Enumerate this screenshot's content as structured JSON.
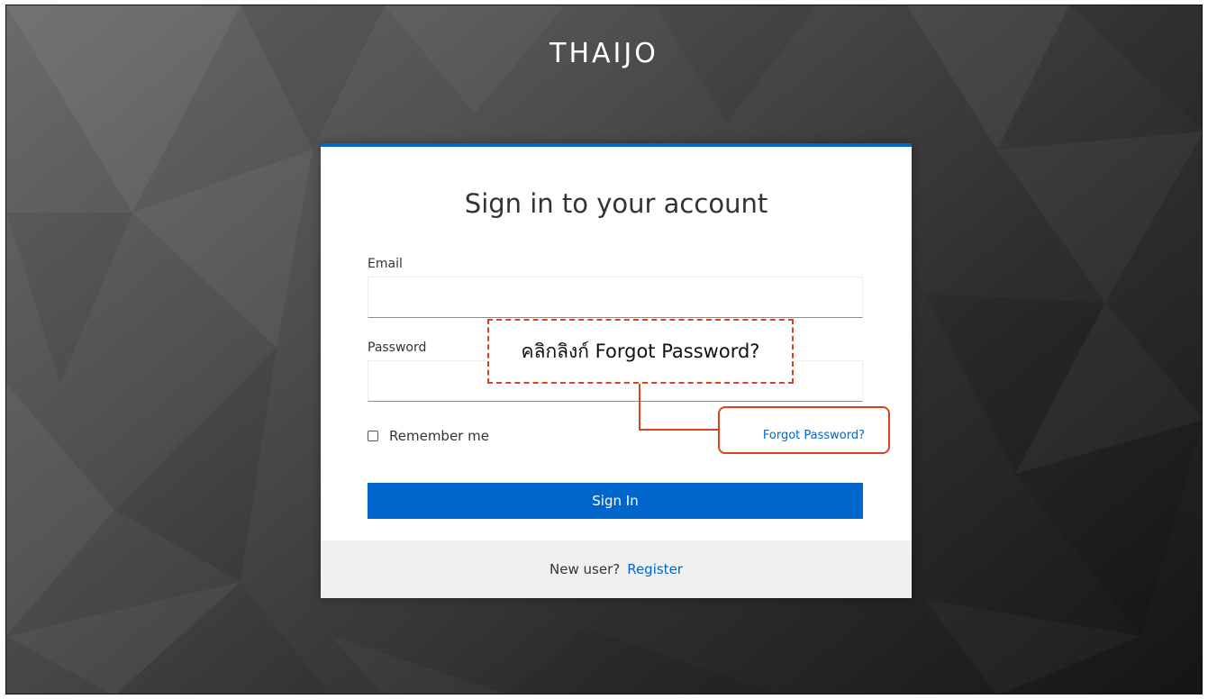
{
  "brand": {
    "title": "THAIJO"
  },
  "login": {
    "heading": "Sign in to your account",
    "email_label": "Email",
    "email_value": "",
    "password_label": "Password",
    "password_value": "",
    "remember_label": "Remember me",
    "remember_checked": false,
    "forgot_link": "Forgot Password?",
    "submit_label": "Sign In",
    "new_user_text": "New user?",
    "register_link": "Register"
  },
  "annotation": {
    "callout_text": "คลิกลิงก์ Forgot Password?"
  },
  "colors": {
    "accent": "#0066cc",
    "annotation": "#d9441c",
    "footer_bg": "#f0f0f0"
  }
}
